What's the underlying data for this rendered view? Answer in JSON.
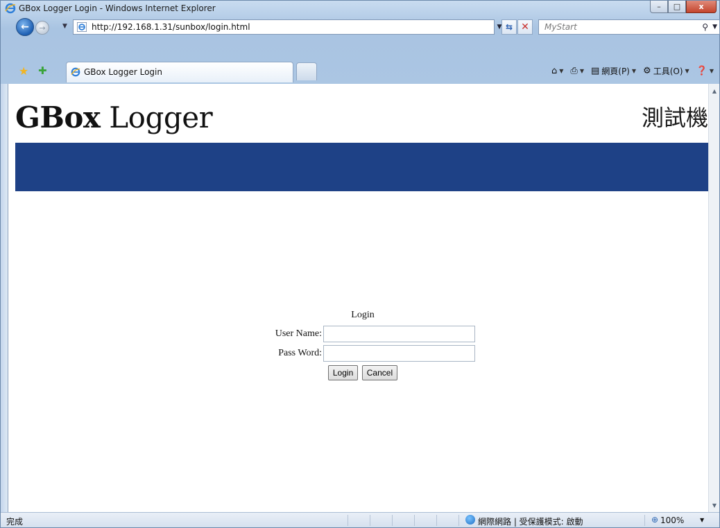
{
  "window": {
    "title": "GBox Logger Login - Windows Internet Explorer",
    "minimize_glyph": "–",
    "maximize_glyph": "□",
    "close_glyph": "x"
  },
  "addressbar": {
    "url": "http://192.168.1.31/sunbox/login.html",
    "search_placeholder": "MyStart"
  },
  "tabs": [
    {
      "label": "GBox Logger Login",
      "active": true
    }
  ],
  "commandbar": {
    "page_label": "網頁(P)",
    "tools_label": "工具(O)"
  },
  "page": {
    "logo_bold": "GBox",
    "logo_rest": " Logger",
    "site_tag": "測試機",
    "banner_color": "#1e4186",
    "login": {
      "title": "Login",
      "username_label": "User Name:",
      "username_value": "",
      "password_label": "Pass Word:",
      "password_value": "",
      "login_button": "Login",
      "cancel_button": "Cancel"
    }
  },
  "statusbar": {
    "status": "完成",
    "zone": "網際網路 | 受保護模式: 啟動",
    "zoom": "100%"
  },
  "icons": {
    "back": "back-arrow-icon",
    "forward": "forward-arrow-icon",
    "favorites": "star-icon",
    "add_favorite": "add-favorite-icon",
    "home": "home-icon",
    "print": "printer-icon",
    "page": "page-icon",
    "tools": "gear-icon",
    "help": "help-icon",
    "search": "search-icon"
  }
}
